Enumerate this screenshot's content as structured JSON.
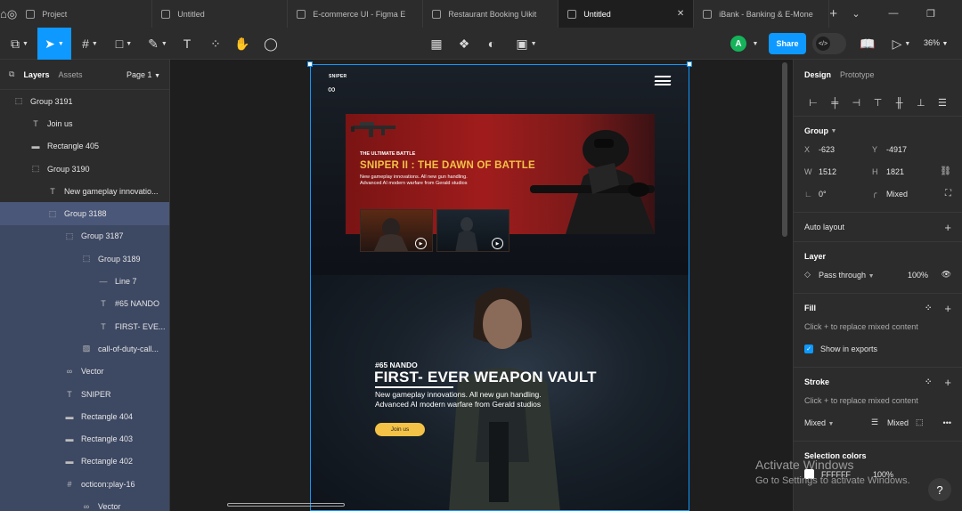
{
  "tabs": {
    "items": [
      {
        "label": "Project"
      },
      {
        "label": "Untitled"
      },
      {
        "label": "E-commerce UI - Figma E"
      },
      {
        "label": "Restaurant Booking Uikit"
      },
      {
        "label": "Untitled",
        "active": true
      },
      {
        "label": "iBank - Banking & E-Mone"
      }
    ],
    "close_glyph": "✕",
    "new_tab_glyph": "+"
  },
  "toolbar": {
    "share_label": "Share",
    "avatar_initial": "A",
    "zoom_label": "36%",
    "accent_color": "#0d99ff"
  },
  "left_panel": {
    "tabs": {
      "layers": "Layers",
      "assets": "Assets"
    },
    "page_label": "Page 1",
    "layers": [
      {
        "name": "Group 3191",
        "icon": "frame-icon",
        "indent": 0
      },
      {
        "name": "Join us",
        "icon": "text-icon",
        "indent": 1
      },
      {
        "name": "Rectangle 405",
        "icon": "rectangle-icon",
        "indent": 1
      },
      {
        "name": "Group 3190",
        "icon": "frame-icon",
        "indent": 1
      },
      {
        "name": "New gameplay innovatio...",
        "icon": "text-icon",
        "indent": 2
      },
      {
        "name": "Group 3188",
        "icon": "frame-icon",
        "indent": 2,
        "selected": true
      },
      {
        "name": "Group 3187",
        "icon": "frame-icon",
        "indent": 3
      },
      {
        "name": "Group 3189",
        "icon": "frame-icon",
        "indent": 4
      },
      {
        "name": "Line 7",
        "icon": "line-icon",
        "indent": 5
      },
      {
        "name": "#65 NANDO",
        "icon": "text-icon",
        "indent": 5
      },
      {
        "name": "FIRST- EVE...",
        "icon": "text-icon",
        "indent": 5
      },
      {
        "name": "call-of-duty-call...",
        "icon": "image-icon",
        "indent": 4
      },
      {
        "name": "Vector",
        "icon": "vector-icon",
        "indent": 3
      },
      {
        "name": "SNIPER",
        "icon": "text-icon",
        "indent": 3
      },
      {
        "name": "Rectangle 404",
        "icon": "rectangle-icon",
        "indent": 3
      },
      {
        "name": "Rectangle 403",
        "icon": "rectangle-icon",
        "indent": 3
      },
      {
        "name": "Rectangle 402",
        "icon": "rectangle-icon",
        "indent": 3
      },
      {
        "name": "octicon:play-16",
        "icon": "hash-icon",
        "indent": 3
      },
      {
        "name": "Vector",
        "icon": "vector-icon",
        "indent": 4
      }
    ]
  },
  "design_frame": {
    "brand": "SNIPER",
    "banner": {
      "kicker": "THE ULTIMATE BATTLE",
      "title": "SNIPER II : THE DAWN OF BATTLE",
      "description": "New gameplay innovations.  All new gun handling. Advanced AI modern warfare from Gerald studios"
    },
    "hero": {
      "kicker": "#65 NANDO",
      "title": "FIRST- EVER WEAPON VAULT",
      "description": "New gameplay innovations.  All new gun handling. Advanced AI modern warfare from Gerald studios",
      "button": "Join us"
    },
    "accent_yellow": "#f3c246",
    "banner_red": "#a01c1c"
  },
  "right_panel": {
    "tabs": {
      "design": "Design",
      "prototype": "Prototype"
    },
    "group_label": "Group",
    "x_label": "X",
    "x_value": "-623",
    "y_label": "Y",
    "y_value": "-4917",
    "w_label": "W",
    "w_value": "1512",
    "h_label": "H",
    "h_value": "1821",
    "rotation_value": "0°",
    "corner_value": "Mixed",
    "auto_layout": "Auto layout",
    "layer_title": "Layer",
    "blend_mode": "Pass through",
    "opacity": "100%",
    "fill_title": "Fill",
    "fill_hint": "Click + to replace mixed content",
    "show_in_exports": "Show in exports",
    "stroke_title": "Stroke",
    "stroke_hint": "Click + to replace mixed content",
    "stroke_position": "Mixed",
    "stroke_weight": "Mixed",
    "selection_colors": "Selection colors",
    "selection_color_hex": "FFFFFF",
    "selection_color_opacity": "100%"
  },
  "watermark": {
    "line1": "Activate Windows",
    "line2": "Go to Settings to activate Windows."
  },
  "help_label": "?"
}
